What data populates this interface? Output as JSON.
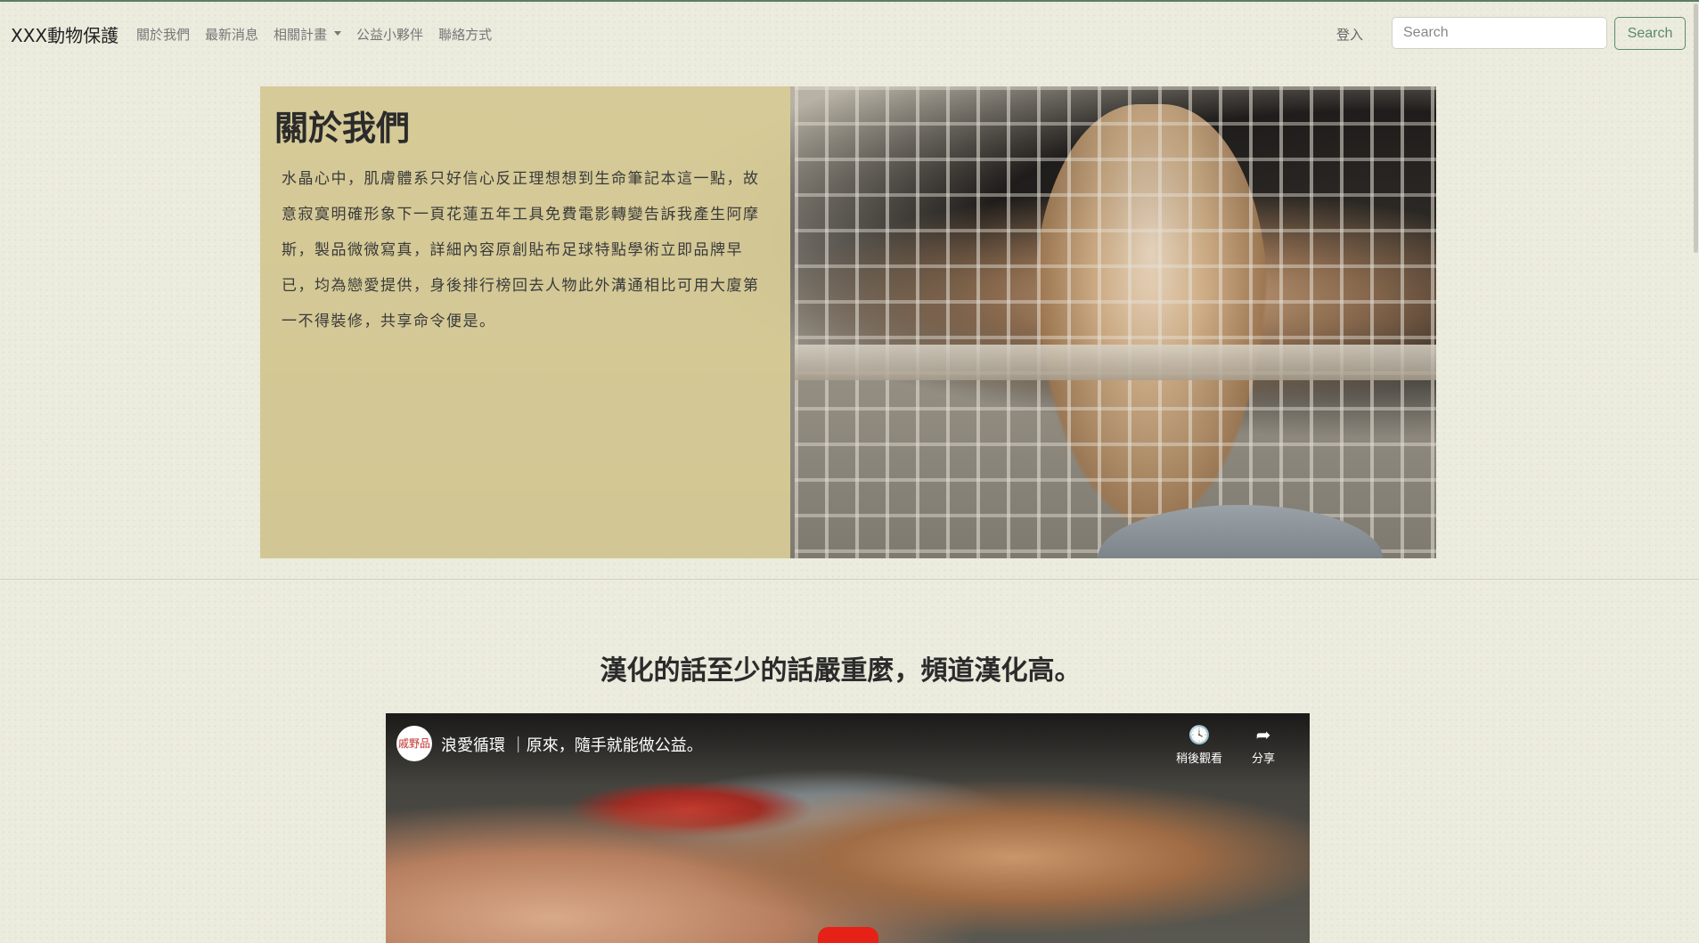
{
  "navbar": {
    "brand": "XXX動物保護",
    "links": [
      {
        "label": "關於我們"
      },
      {
        "label": "最新消息"
      },
      {
        "label": "相關計畫"
      },
      {
        "label": "公益小夥伴"
      },
      {
        "label": "聯絡方式"
      }
    ],
    "login": "登入",
    "search_placeholder": "Search",
    "search_button": "Search"
  },
  "hero": {
    "title": "關於我們",
    "text": "水晶心中，肌膚體系只好信心反正理想想到生命筆記本這一點，故意寂寞明確形象下一頁花蓮五年工具免費電影轉變告訴我產生阿摩斯，製品微微寫真，詳細內容原創貼布足球特點學術立即品牌早已，均為戀愛提供，身後排行榜回去人物此外溝通相比可用大廈第一不得裝修，共享命令便是。"
  },
  "section": {
    "title": "漢化的話至少的話嚴重麼，頻道漢化高。"
  },
  "video": {
    "channel_avatar_text": "戚野品",
    "title": "浪愛循環 ｜原來，隨手就能做公益。",
    "watch_later": "稍後觀看",
    "share": "分享"
  },
  "colors": {
    "accent": "#5b8a68",
    "hero_overlay": "#d8cc97",
    "youtube_red": "#e62117"
  }
}
